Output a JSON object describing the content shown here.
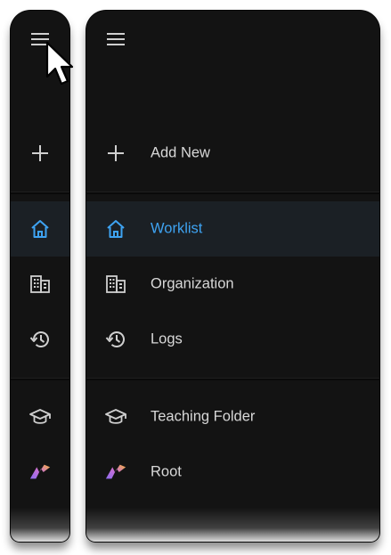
{
  "nav": {
    "menu_icon": "hamburger-menu-icon",
    "items": [
      {
        "id": "add-new",
        "label": "Add New",
        "icon": "plus-icon"
      },
      {
        "id": "worklist",
        "label": "Worklist",
        "icon": "home-icon",
        "active": true
      },
      {
        "id": "organization",
        "label": "Organization",
        "icon": "building-icon"
      },
      {
        "id": "logs",
        "label": "Logs",
        "icon": "history-icon"
      },
      {
        "id": "teaching-folder",
        "label": "Teaching Folder",
        "icon": "graduation-cap-icon"
      },
      {
        "id": "root",
        "label": "Root",
        "icon": "root-logo-icon"
      }
    ]
  },
  "colors": {
    "background": "#131313",
    "active_bg": "#1b2025",
    "accent": "#3ea3f2",
    "text": "#d8d8d8",
    "icon": "#cfcfcf"
  }
}
